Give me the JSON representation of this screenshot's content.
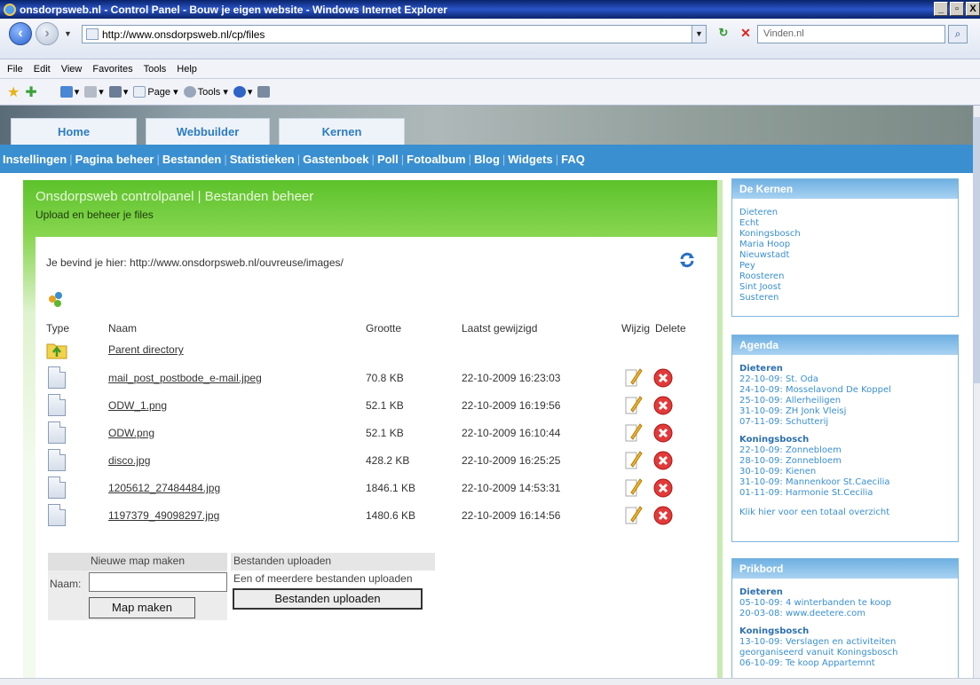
{
  "window": {
    "title": "onsdorpsweb.nl - Control Panel - Bouw je eigen website - Windows Internet Explorer",
    "min": "_",
    "max": "▫",
    "close": "X"
  },
  "address": {
    "url": "http://www.onsdorpsweb.nl/cp/files",
    "search_placeholder": "Vinden.nl"
  },
  "menu": [
    "File",
    "Edit",
    "View",
    "Favorites",
    "Tools",
    "Help"
  ],
  "commandbar": {
    "page_label": "Page ▾",
    "tools_label": "Tools ▾"
  },
  "tabs": [
    {
      "label": "Home"
    },
    {
      "label": "Webbuilder"
    },
    {
      "label": "Kernen"
    }
  ],
  "subnav": [
    "Instellingen",
    "Pagina beheer",
    "Bestanden",
    "Statistieken",
    "Gastenboek",
    "Poll",
    "Fotoalbum",
    "Blog",
    "Widgets",
    "FAQ"
  ],
  "panel": {
    "title": "Onsdorpsweb controlpanel | Bestanden beheer",
    "subtitle": "Upload en beheer je files",
    "breadcrumb": "Je bevind je hier: http://www.onsdorpsweb.nl/ouvreuse/images/"
  },
  "table": {
    "headers": {
      "type": "Type",
      "name": "Naam",
      "size": "Grootte",
      "modified": "Laatst gewijzigd",
      "edit": "Wijzig",
      "delete": "Delete"
    },
    "parent": "Parent directory",
    "rows": [
      {
        "name": "mail_post_postbode_e-mail.jpeg",
        "size": "70.8 KB",
        "date": "22-10-2009 16:23:03"
      },
      {
        "name": "ODW_1.png",
        "size": "52.1 KB",
        "date": "22-10-2009 16:19:56"
      },
      {
        "name": "ODW.png",
        "size": "52.1 KB",
        "date": "22-10-2009 16:10:44"
      },
      {
        "name": "disco.jpg",
        "size": "428.2 KB",
        "date": "22-10-2009 16:25:25"
      },
      {
        "name": "1205612_27484484.jpg",
        "size": "1846.1 KB",
        "date": "22-10-2009 14:53:31"
      },
      {
        "name": "1197379_49098297.jpg",
        "size": "1480.6 KB",
        "date": "22-10-2009 16:14:56"
      }
    ]
  },
  "newdir": {
    "title": "Nieuwe map maken",
    "label": "Naam:",
    "button": "Map maken"
  },
  "upload": {
    "title": "Bestanden uploaden",
    "subtitle": "Een of meerdere bestanden uploaden",
    "button": "Bestanden uploaden"
  },
  "sidebar": {
    "kernen": {
      "title": "De Kernen",
      "items": [
        "Dieteren",
        "Echt",
        "Koningsbosch",
        "Maria Hoop",
        "Nieuwstadt",
        "Pey",
        "Roosteren",
        "Sint Joost",
        "Susteren"
      ]
    },
    "agenda": {
      "title": "Agenda",
      "groups": [
        {
          "name": "Dieteren",
          "items": [
            "22-10-09: St. Oda",
            "24-10-09: Mosselavond De Koppel",
            "25-10-09: Allerheiligen",
            "31-10-09: ZH Jonk Vleisj",
            "07-11-09: Schutterij"
          ]
        },
        {
          "name": "Koningsbosch",
          "items": [
            "22-10-09: Zonnebloem",
            "28-10-09: Zonnebloem",
            "30-10-09: Kienen",
            "31-10-09: Mannenkoor St.Caecilia",
            "01-11-09: Harmonie St.Cecilia"
          ]
        }
      ],
      "footer": "Klik hier voor een totaal overzicht"
    },
    "prikbord": {
      "title": "Prikbord",
      "groups": [
        {
          "name": "Dieteren",
          "items": [
            "05-10-09: 4 winterbanden te koop",
            "20-03-08: www.deetere.com"
          ]
        },
        {
          "name": "Koningsbosch",
          "items": [
            "13-10-09: Verslagen en activiteiten",
            "georganiseerd vanuit Koningsbosch",
            "06-10-09: Te koop Appartemnt"
          ]
        }
      ]
    }
  },
  "colors": {
    "accent_blue": "#3a8fd0",
    "panel_green": "#5cc22b",
    "delete_red": "#e23a3a"
  }
}
